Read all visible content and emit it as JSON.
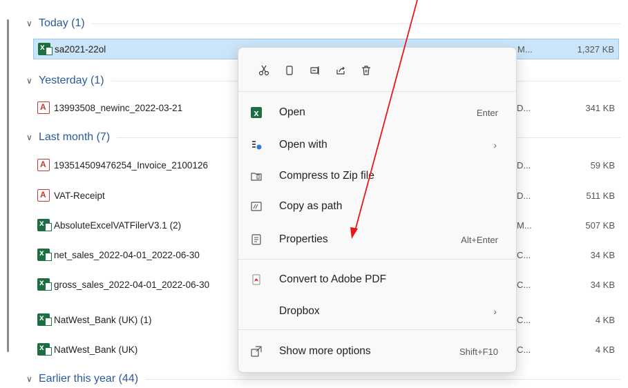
{
  "groups": [
    {
      "label": "Today (1)"
    },
    {
      "label": "Yesterday (1)"
    },
    {
      "label": "Last month (7)"
    },
    {
      "label": "Earlier this year (44)"
    }
  ],
  "files": [
    {
      "name": "sa2021-22ol",
      "type": "M...",
      "size": "1,327 KB",
      "icon": "excel-icon"
    },
    {
      "name": "13993508_newinc_2022-03-21",
      "type": "D...",
      "size": "341 KB",
      "icon": "pdf-icon"
    },
    {
      "name": "193514509476254_Invoice_2100126",
      "type": "D...",
      "size": "59 KB",
      "icon": "pdf-icon"
    },
    {
      "name": "VAT-Receipt",
      "type": "D...",
      "size": "511 KB",
      "icon": "pdf-icon"
    },
    {
      "name": "AbsoluteExcelVATFilerV3.1 (2)",
      "type": "M...",
      "size": "507 KB",
      "icon": "excel-icon"
    },
    {
      "name": "net_sales_2022-04-01_2022-06-30",
      "type": "C...",
      "size": "34 KB",
      "icon": "excel-icon"
    },
    {
      "name": "gross_sales_2022-04-01_2022-06-30",
      "type": "C...",
      "size": "34 KB",
      "icon": "excel-icon"
    },
    {
      "name": "NatWest_Bank (UK) (1)",
      "type": "C...",
      "size": "4 KB",
      "icon": "excel-icon"
    },
    {
      "name": "NatWest_Bank (UK)",
      "type": "C...",
      "size": "4 KB",
      "icon": "excel-icon"
    }
  ],
  "context_menu": {
    "toolbar_icons": [
      "cut-icon",
      "copy-icon",
      "rename-icon",
      "share-icon",
      "delete-icon"
    ],
    "items": [
      {
        "label": "Open",
        "shortcut": "Enter",
        "icon": "excel-icon"
      },
      {
        "label": "Open with",
        "submenu": "›",
        "icon": "open-with-icon"
      },
      {
        "label": "Compress to Zip file",
        "icon": "zip-icon"
      },
      {
        "label": "Copy as path",
        "icon": "path-icon"
      },
      {
        "label": "Properties",
        "shortcut": "Alt+Enter",
        "icon": "properties-icon"
      },
      {
        "label": "Convert to Adobe PDF",
        "icon": "adobe-pdf-icon"
      },
      {
        "label": "Dropbox",
        "submenu": "›",
        "icon": ""
      },
      {
        "label": "Show more options",
        "shortcut": "Shift+F10",
        "icon": "more-options-icon"
      }
    ]
  },
  "colors": {
    "annotation_arrow": "#e8151b",
    "selection": "#cce4f7",
    "group_header": "#2a5a9a"
  }
}
